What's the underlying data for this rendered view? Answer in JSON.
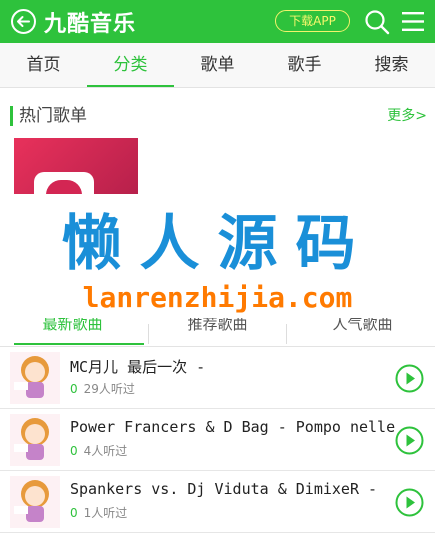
{
  "header": {
    "logo": "九酷音乐",
    "download_label": "下载APP"
  },
  "nav": {
    "tabs": [
      {
        "label": "首页",
        "active": false
      },
      {
        "label": "分类",
        "active": true
      },
      {
        "label": "歌单",
        "active": false
      },
      {
        "label": "歌手",
        "active": false
      },
      {
        "label": "搜索",
        "active": false
      }
    ]
  },
  "hot_section": {
    "title": "热门歌单",
    "more": "更多>"
  },
  "watermark": {
    "cn": "懒人源码",
    "en": "lanrenzhijia.com"
  },
  "subtabs": [
    {
      "label": "最新歌曲",
      "active": true
    },
    {
      "label": "推荐歌曲",
      "active": false
    },
    {
      "label": "人气歌曲",
      "active": false
    }
  ],
  "songs": [
    {
      "title": "MC月儿 最后一次 -",
      "count": "0",
      "listeners": "29人听过"
    },
    {
      "title": "Power Francers & D Bag - Pompo nelle",
      "count": "0",
      "listeners": "4人听过"
    },
    {
      "title": "Spankers vs. Dj Viduta & DimixeR -",
      "count": "0",
      "listeners": "1人听过"
    }
  ],
  "colors": {
    "accent": "#2ec23c",
    "watermark_blue": "#1a8fd8",
    "watermark_orange": "#ff7a00"
  },
  "icons": {
    "back": "back-arrow-icon",
    "search": "search-icon",
    "menu": "menu-icon",
    "play": "play-icon"
  }
}
